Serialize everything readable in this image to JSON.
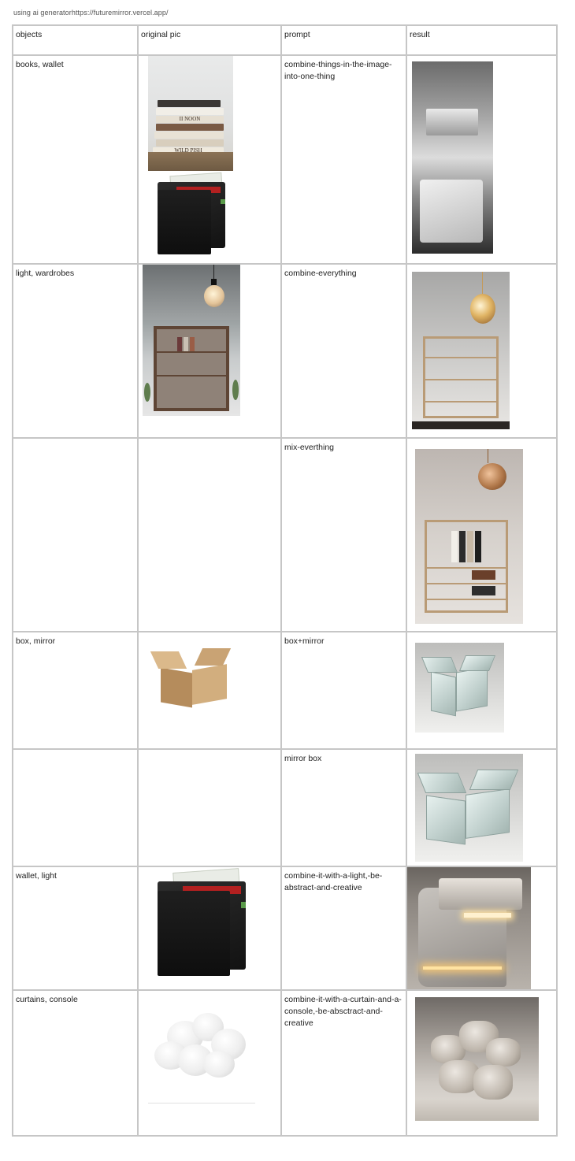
{
  "header_note": "using ai generatorhttps://futuremirror.vercel.app/",
  "table": {
    "headers": [
      "objects",
      "original pic",
      "prompt",
      "result"
    ],
    "rows": [
      {
        "objects": "books, wallet",
        "prompt": "combine-things-in-the-image-into-one-thing"
      },
      {
        "objects": "light, wardrobes",
        "prompt": "combine-everything"
      },
      {
        "objects": "",
        "prompt": "mix-everthing"
      },
      {
        "objects": "box, mirror",
        "prompt": "box+mirror"
      },
      {
        "objects": "",
        "prompt": "mirror box"
      },
      {
        "objects": "wallet, light",
        "prompt": "combine-it-with-a-light,-be-abstract-and-creative"
      },
      {
        "objects": "curtains, console",
        "prompt": "combine-it-with-a-curtain-and-a-console,-be-absctract-and-creative"
      }
    ]
  },
  "book_spines": [
    "",
    "",
    "II NOON",
    "",
    "",
    "",
    "WILD PISH"
  ]
}
